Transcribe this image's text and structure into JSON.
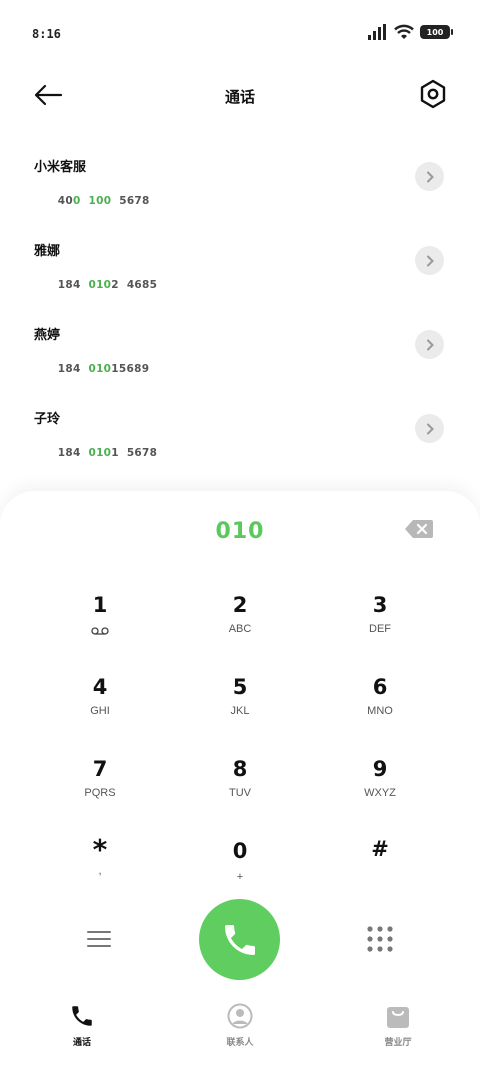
{
  "status_bar": {
    "time": "8:16",
    "battery": "100"
  },
  "header": {
    "title": "通话",
    "back_icon": "arrow-left-icon",
    "settings_icon": "hexagon-settings-icon"
  },
  "contacts": [
    {
      "name": "小米客服",
      "number_parts": [
        [
          "40",
          false
        ],
        [
          "0",
          true
        ],
        [
          "  ",
          false
        ],
        [
          "100",
          true
        ],
        [
          "  5678",
          false
        ]
      ]
    },
    {
      "name": "雅娜",
      "number_parts": [
        [
          "184  ",
          false
        ],
        [
          "010",
          true
        ],
        [
          "2  4685",
          false
        ]
      ]
    },
    {
      "name": "燕婷",
      "number_parts": [
        [
          "184  ",
          false
        ],
        [
          "010",
          true
        ],
        [
          "15689",
          false
        ]
      ]
    },
    {
      "name": "子玲",
      "number_parts": [
        [
          "184  ",
          false
        ],
        [
          "010",
          true
        ],
        [
          "1  5678",
          false
        ]
      ]
    }
  ],
  "dialpad": {
    "input_value": "010",
    "keys": [
      [
        {
          "digit": "1",
          "letters": "",
          "icon": "voicemail-icon"
        },
        {
          "digit": "2",
          "letters": "ABC"
        },
        {
          "digit": "3",
          "letters": "DEF"
        }
      ],
      [
        {
          "digit": "4",
          "letters": "GHI"
        },
        {
          "digit": "5",
          "letters": "JKL"
        },
        {
          "digit": "6",
          "letters": "MNO"
        }
      ],
      [
        {
          "digit": "7",
          "letters": "PQRS"
        },
        {
          "digit": "8",
          "letters": "TUV"
        },
        {
          "digit": "9",
          "letters": "WXYZ"
        }
      ],
      [
        {
          "digit": "*",
          "letters": ","
        },
        {
          "digit": "0",
          "letters": "+"
        },
        {
          "digit": "#",
          "letters": ""
        }
      ]
    ]
  },
  "bottom_nav": {
    "items": [
      {
        "label": "通话",
        "icon": "phone-icon",
        "active": true
      },
      {
        "label": "联系人",
        "icon": "person-icon",
        "active": false
      },
      {
        "label": "营业厅",
        "icon": "shopping-bag-icon",
        "active": false
      }
    ]
  },
  "colors": {
    "accent": "#5fcd5f",
    "highlight": "#4caf50"
  }
}
